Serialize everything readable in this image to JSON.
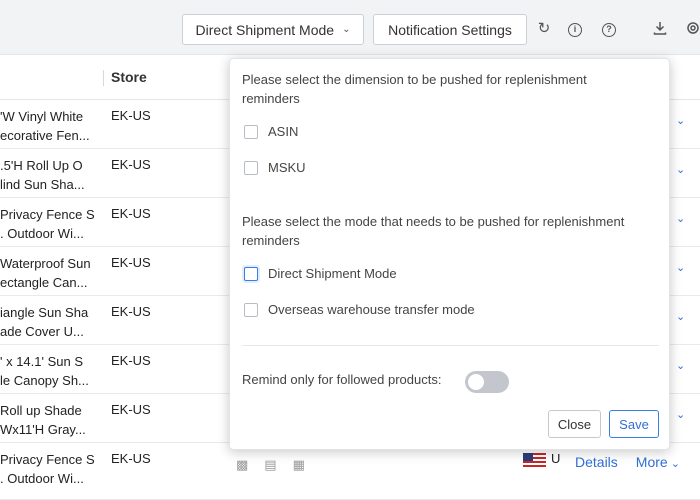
{
  "toolbar": {
    "mode_label": "Direct Shipment Mode",
    "notification_label": "Notification Settings",
    "icons": [
      "refresh-icon",
      "info-icon",
      "help-icon",
      "download-icon",
      "settings-icon"
    ]
  },
  "table": {
    "store_header": "Store",
    "rows": [
      {
        "name_line1": "'W Vinyl White",
        "name_line2": "ecorative Fen...",
        "store": "EK-US"
      },
      {
        "name_line1": ".5'H Roll Up O",
        "name_line2": "lind Sun Sha...",
        "store": "EK-US"
      },
      {
        "name_line1": "Privacy Fence S",
        "name_line2": ". Outdoor Wi...",
        "store": "EK-US"
      },
      {
        "name_line1": "Waterproof Sun",
        "name_line2": "ectangle Can...",
        "store": "EK-US"
      },
      {
        "name_line1": "iangle Sun Sha",
        "name_line2": "ade Cover U...",
        "store": "EK-US"
      },
      {
        "name_line1": "' x 14.1' Sun S",
        "name_line2": "le Canopy Sh...",
        "store": "EK-US"
      },
      {
        "name_line1": "Roll up Shade",
        "name_line2": "Wx11'H Gray...",
        "store": "EK-US"
      },
      {
        "name_line1": "Privacy Fence S",
        "name_line2": ". Outdoor Wi...",
        "store": "EK-US",
        "country": "U",
        "details": "Details",
        "more": "More"
      }
    ]
  },
  "popover": {
    "dimension_question": "Please select the dimension to be pushed for replenishment reminders",
    "dimension_options": [
      "ASIN",
      "MSKU"
    ],
    "mode_question": "Please select the mode that needs to be pushed for replenishment reminders",
    "mode_options": [
      "Direct Shipment Mode",
      "Overseas warehouse transfer mode"
    ],
    "remind_label": "Remind only for followed products:",
    "remind_followed_only": false,
    "close_label": "Close",
    "save_label": "Save"
  },
  "colors": {
    "accent": "#2f6fd6",
    "toggle_off": "#c3c7cd"
  }
}
